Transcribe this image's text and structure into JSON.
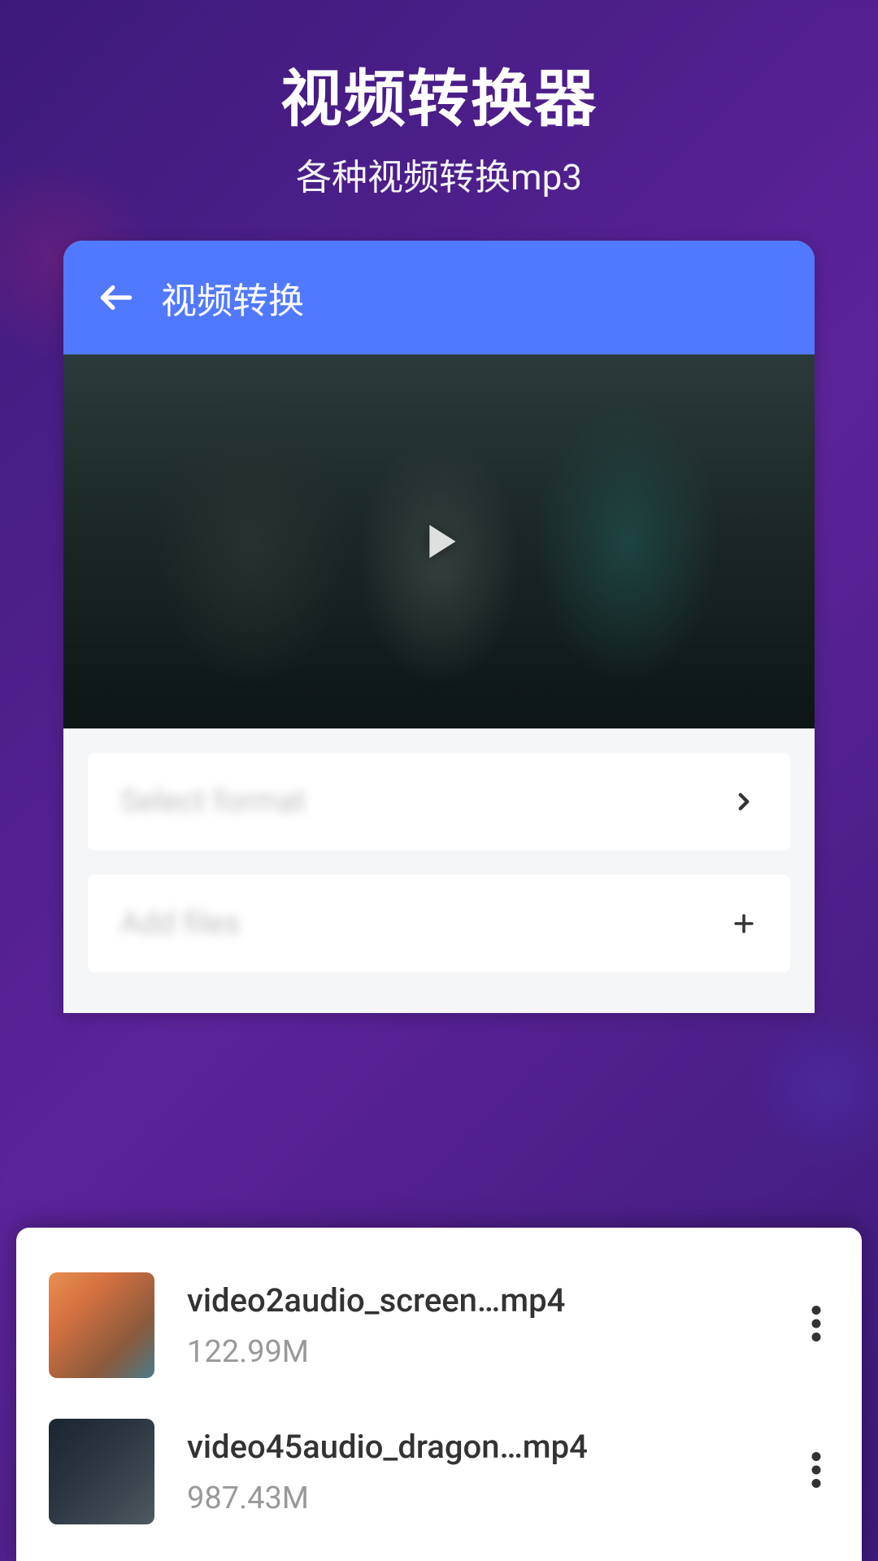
{
  "header": {
    "title": "视频转换器",
    "subtitle": "各种视频转换mp3"
  },
  "card": {
    "header_title": "视频转换",
    "options": {
      "select_format_label": "Select format",
      "add_files_label": "Add files"
    }
  },
  "files": [
    {
      "name": "video2audio_screen…mp4",
      "size": "122.99M"
    },
    {
      "name": "video45audio_dragon…mp4",
      "size": "987.43M"
    }
  ],
  "colors": {
    "primary": "#5179ff",
    "background_gradient_start": "#3d1a7a",
    "background_gradient_end": "#5b2399"
  }
}
